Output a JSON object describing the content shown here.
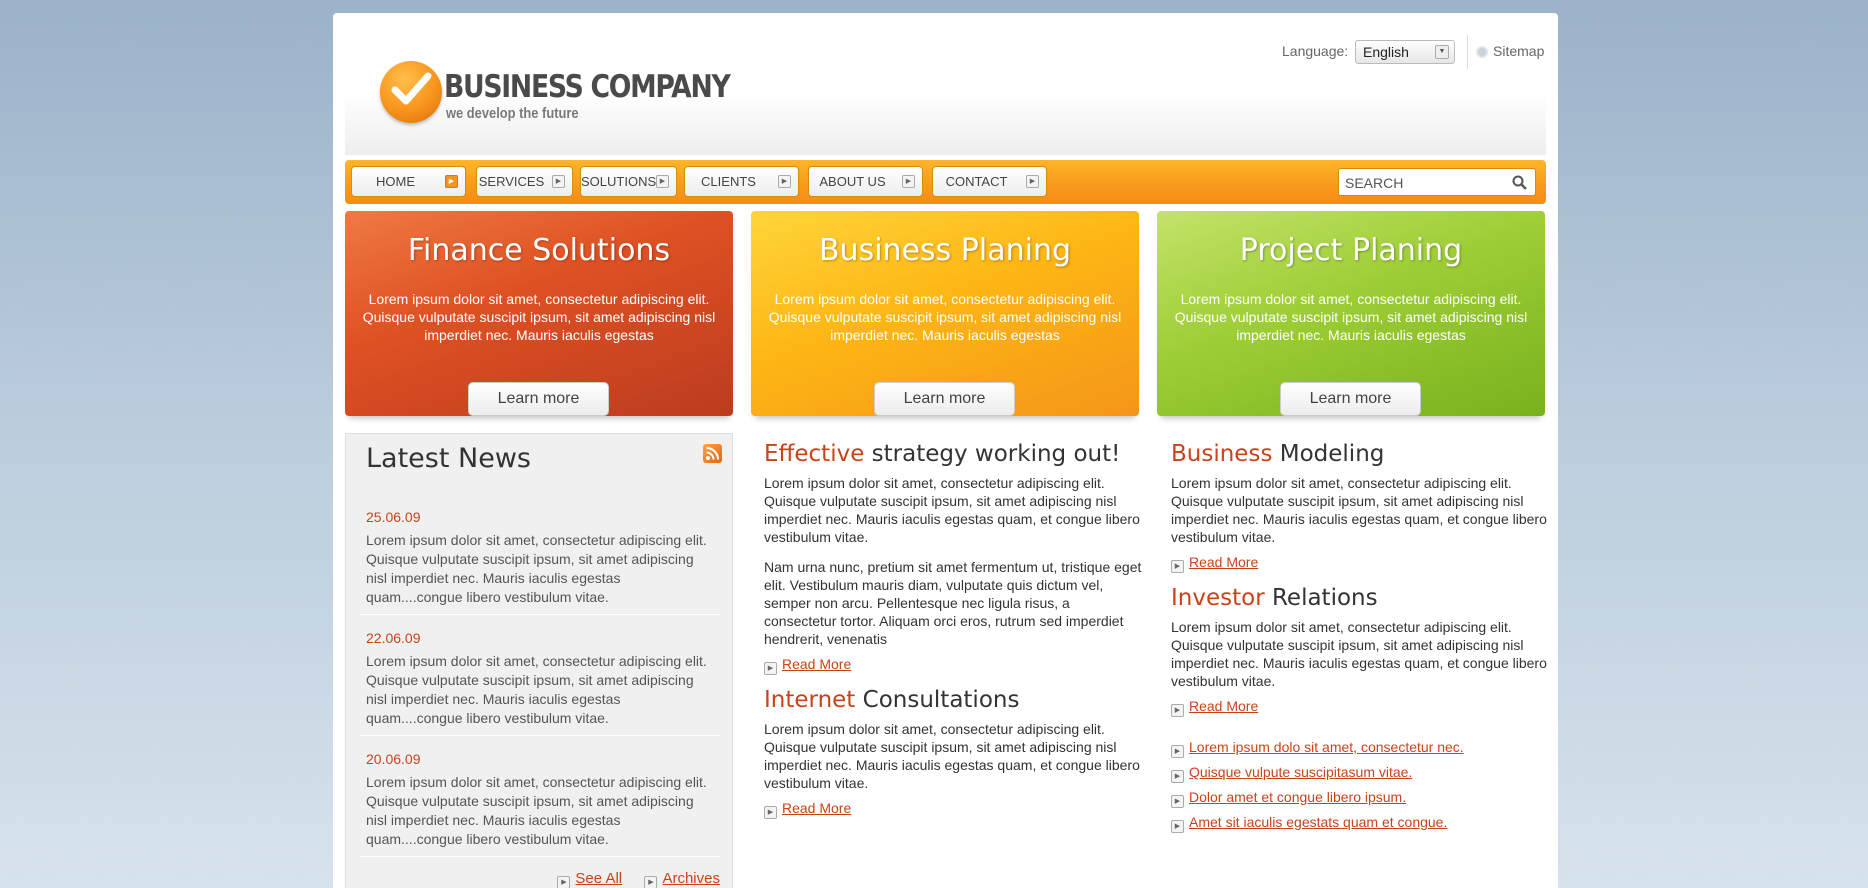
{
  "header": {
    "brand_name": "BUSINESS COMPANY",
    "tagline": "we develop the future",
    "language_label": "Language:",
    "language_value": "English",
    "sitemap_label": "Sitemap"
  },
  "nav": {
    "items": [
      {
        "label": "HOME",
        "active": true
      },
      {
        "label": "SERVICES"
      },
      {
        "label": "SOLUTIONS"
      },
      {
        "label": "CLIENTS"
      },
      {
        "label": "ABOUT US"
      },
      {
        "label": "CONTACT"
      }
    ],
    "search_placeholder": "SEARCH"
  },
  "promos": [
    {
      "title": "Finance Solutions",
      "text": "Lorem ipsum dolor sit amet, consectetur adipiscing elit. Quisque vulputate suscipit ipsum, sit amet adipiscing nisl imperdiet nec. Mauris iaculis egestas",
      "button": "Learn more",
      "color": "#de5123"
    },
    {
      "title": "Business Planing",
      "text": "Lorem ipsum dolor sit amet, consectetur adipiscing elit. Quisque vulputate suscipit ipsum, sit amet adipiscing nisl imperdiet nec. Mauris iaculis egestas",
      "button": "Learn more",
      "color": "#fdb614"
    },
    {
      "title": "Project Planing",
      "text": "Lorem ipsum dolor sit amet, consectetur adipiscing elit. Quisque vulputate suscipit ipsum, sit amet adipiscing nisl imperdiet nec. Mauris iaculis egestas",
      "button": "Learn more",
      "color": "#9ccd34"
    }
  ],
  "news": {
    "title": "Latest News",
    "items": [
      {
        "date": "25.06.09",
        "text": "Lorem ipsum dolor sit amet, consectetur adipiscing elit. Quisque vulputate suscipit ipsum, sit amet adipiscing nisl imperdiet nec. Mauris iaculis egestas quam....congue libero vestibulum vitae."
      },
      {
        "date": "22.06.09",
        "text": "Lorem ipsum dolor sit amet, consectetur adipiscing elit. Quisque vulputate suscipit ipsum, sit amet adipiscing nisl imperdiet nec. Mauris iaculis egestas quam....congue libero vestibulum vitae."
      },
      {
        "date": "20.06.09",
        "text": "Lorem ipsum dolor sit amet, consectetur adipiscing elit. Quisque vulputate suscipit ipsum, sit amet adipiscing nisl imperdiet nec. Mauris iaculis egestas quam....congue libero vestibulum vitae."
      }
    ],
    "see_all": "See All",
    "archives": "Archives"
  },
  "articles": {
    "effective": {
      "highlight": "Effective",
      "rest": " strategy working out!",
      "p1": "Lorem ipsum dolor sit amet, consectetur adipiscing elit. Quisque vulputate suscipit ipsum, sit amet adipiscing nisl imperdiet nec. Mauris iaculis egestas quam, et congue libero vestibulum vitae.",
      "p2": "Nam urna nunc, pretium sit amet fermentum ut, tristique eget elit. Vestibulum mauris diam, vulputate quis dictum vel, semper non arcu. Pellentesque nec ligula risus, a consectetur tortor. Aliquam orci eros, rutrum sed imperdiet hendrerit, venenatis",
      "more": "Read More"
    },
    "internet": {
      "highlight": "Internet",
      "rest": " Consultations",
      "p1": "Lorem ipsum dolor sit amet, consectetur adipiscing elit. Quisque vulputate suscipit ipsum, sit amet adipiscing nisl imperdiet nec. Mauris iaculis egestas quam, et congue libero vestibulum vitae.",
      "more": "Read More"
    },
    "business": {
      "highlight": "Business",
      "rest": " Modeling",
      "p1": "Lorem ipsum dolor sit amet, consectetur adipiscing elit. Quisque vulputate suscipit ipsum, sit amet adipiscing nisl imperdiet nec. Mauris iaculis egestas quam, et congue libero vestibulum vitae.",
      "more": "Read More"
    },
    "investor": {
      "highlight": "Investor",
      "rest": " Relations",
      "p1": "Lorem ipsum dolor sit amet, consectetur adipiscing elit. Quisque vulputate suscipit ipsum, sit amet adipiscing nisl imperdiet nec. Mauris iaculis egestas quam, et congue libero vestibulum vitae.",
      "more": "Read More"
    }
  },
  "links": [
    "Lorem ipsum dolo sit amet, consectetur nec.",
    "Quisque vulpute suscipitasum vitae.",
    "Dolor amet et congue libero ipsum.",
    "Amet sit iaculis egestats quam et congue."
  ],
  "colors": {
    "accent": "#c9431a",
    "nav_orange": "#f8991b"
  }
}
